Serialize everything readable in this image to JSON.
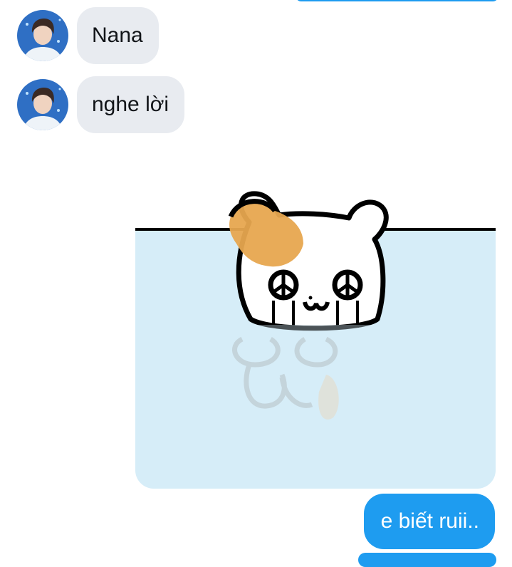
{
  "conversation": {
    "incoming": [
      {
        "text": "Nana"
      },
      {
        "text": "nghe lời"
      }
    ],
    "sticker": {
      "description_icon": "crying-hamster-sticker"
    },
    "outgoing": [
      {
        "text": "e biết ruii.."
      }
    ]
  },
  "colors": {
    "outgoing_bubble": "#1e9cf0",
    "incoming_bubble": "#e8ebf0",
    "sticker_water": "#d6edf8"
  }
}
